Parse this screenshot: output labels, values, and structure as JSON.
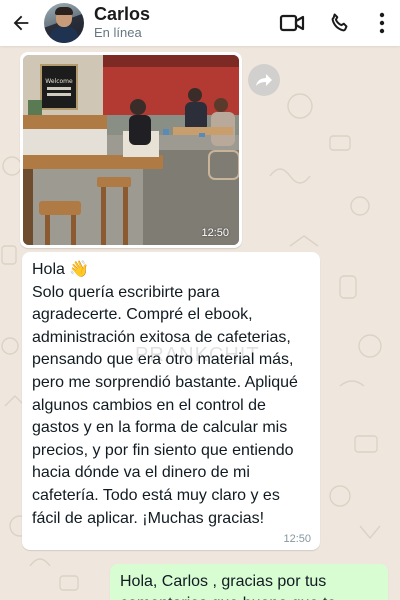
{
  "header": {
    "contact_name": "Carlos",
    "contact_status": "En línea"
  },
  "messages": [
    {
      "type": "image",
      "direction": "incoming",
      "time": "12:50",
      "photo_sign_text": "Welcome"
    },
    {
      "type": "text",
      "direction": "incoming",
      "text": "Hola 👋\nSolo quería escribirte para agradecerte. Compré el ebook, administración exitosa de cafeterias,  pensando que era otro material más, pero me sorprendió bastante. Apliqué algunos cambios en el control de gastos y en la forma de calcular mis precios, y por fin siento que entiendo hacia dónde va el dinero de mi cafetería. Todo está muy claro y es fácil de aplicar. ¡Muchas gracias!",
      "time": "12:50",
      "watermark": "PRANKCHIT"
    },
    {
      "type": "text",
      "direction": "outgoing",
      "text": "Hola, Carlos , gracias por tus\ncomentarios que bueno que te"
    }
  ],
  "icons": {
    "back": "arrow-left-icon",
    "video": "video-camera-icon",
    "call": "phone-icon",
    "menu": "more-vertical-icon",
    "forward": "forward-arrow-icon"
  },
  "colors": {
    "header_bg": "#ffffff",
    "chat_bg": "#efe7dd",
    "incoming_bubble": "#ffffff",
    "outgoing_bubble": "#d9fdd3",
    "secondary_text": "#667781"
  }
}
